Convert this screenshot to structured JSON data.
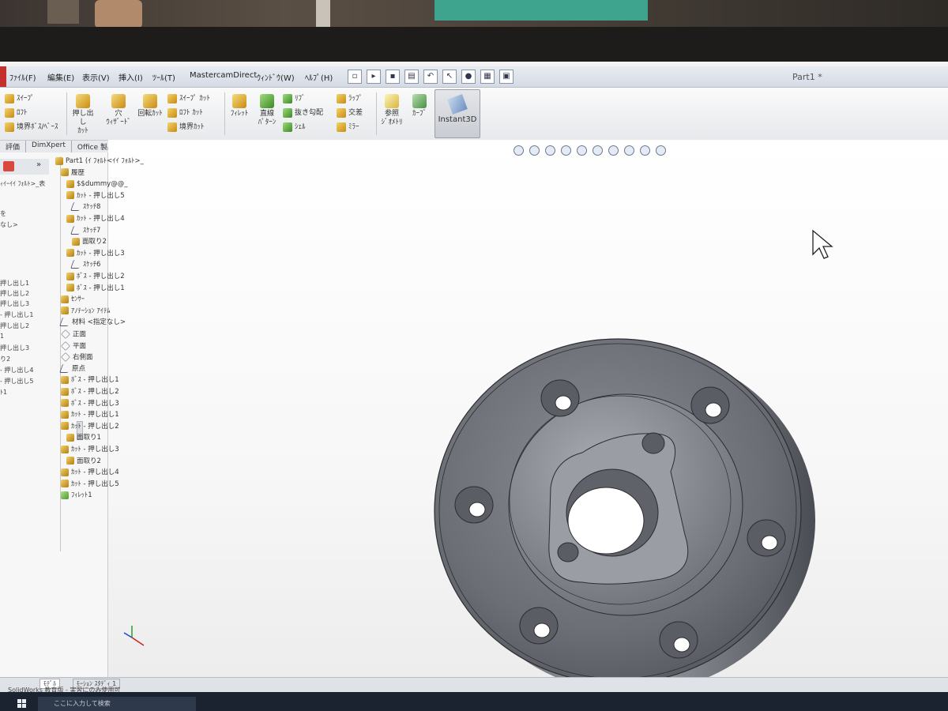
{
  "window": {
    "doc_title": "Part1 *"
  },
  "menu": [
    {
      "label": "ﾌｧｲﾙ(F)"
    },
    {
      "label": "編集(E)"
    },
    {
      "label": "表示(V)"
    },
    {
      "label": "挿入(I)"
    },
    {
      "label": "ﾂｰﾙ(T)"
    },
    {
      "label": "MastercamDirect"
    },
    {
      "label": "ｳｨﾝﾄﾞｳ(W)"
    },
    {
      "label": "ﾍﾙﾌﾟ(H)"
    }
  ],
  "ribbon": {
    "sweep": "ｽｲｰﾌﾟ",
    "loft": "ﾛﾌﾄ",
    "boundary_boss": "境界ﾎﾞｽ/ﾍﾞｰｽ",
    "extrude_cut": "押し出し\nｶｯﾄ",
    "hole_wizard": "穴\nｳｨｻﾞｰﾄﾞ",
    "revolve_cut": "回転ｶｯﾄ",
    "sweep_cut": "ｽｲｰﾌﾟ ｶｯﾄ",
    "loft_cut": "ﾛﾌﾄ ｶｯﾄ",
    "boundary_cut": "境界ｶｯﾄ",
    "fillet": "ﾌｨﾚｯﾄ",
    "linear_pattern": "直線\nﾊﾟﾀｰﾝ",
    "rib": "ﾘﾌﾞ",
    "draft": "抜き勾配",
    "shell": "ｼｪﾙ",
    "wrap": "ﾗｯﾌﾟ",
    "intersect": "交差",
    "mirror": "ﾐﾗｰ",
    "ref_geometry": "参照\nｼﾞｵﾒﾄﾘ",
    "curves": "ｶｰﾌﾞ",
    "instant3d": "Instant3D"
  },
  "tabs": [
    {
      "label": "評価"
    },
    {
      "label": "DimXpert"
    },
    {
      "label": "Office 製品"
    }
  ],
  "left_panel": {
    "lines": [
      "ｨｲｰｲｲ ﾌｫﾙﾄ>_表",
      "を",
      "なし>",
      "押し出し1",
      "押し出し2",
      "押し出し3",
      "- 押し出し1",
      "押し出し2",
      "1",
      "押し出し3",
      "り2",
      "- 押し出し4",
      "- 押し出し5",
      "ﾄ1"
    ]
  },
  "tree": [
    {
      "label": "Part1 (ｲ ﾌｫﾙﾄ<ｲｲ ﾌｫﾙﾄ>_",
      "icon": "part"
    },
    {
      "label": "履歴",
      "icon": "folder"
    },
    {
      "label": "$$dummy@@_",
      "icon": "feat"
    },
    {
      "label": "ｶｯﾄ - 押し出し5",
      "icon": "feat"
    },
    {
      "label": "ｽｹｯﾁ8",
      "icon": "sketch"
    },
    {
      "label": "ｶｯﾄ - 押し出し4",
      "icon": "feat"
    },
    {
      "label": "ｽｹｯﾁ7",
      "icon": "sketch"
    },
    {
      "label": "面取り2",
      "icon": "feat"
    },
    {
      "label": "ｶｯﾄ - 押し出し3",
      "icon": "feat"
    },
    {
      "label": "ｽｹｯﾁ6",
      "icon": "sketch"
    },
    {
      "label": "ﾎﾞｽ - 押し出し2",
      "icon": "feat"
    },
    {
      "label": "ﾎﾞｽ - 押し出し1",
      "icon": "feat"
    },
    {
      "label": "ｾﾝｻｰ",
      "icon": "feat"
    },
    {
      "label": "ｱﾉﾃｰｼｮﾝ ｱｲﾃﾑ",
      "icon": "feat"
    },
    {
      "label": "材料 <指定なし>",
      "icon": "sketch"
    },
    {
      "label": "正面",
      "icon": "plane"
    },
    {
      "label": "平面",
      "icon": "plane"
    },
    {
      "label": "右側面",
      "icon": "plane"
    },
    {
      "label": "原点",
      "icon": "sketch"
    },
    {
      "label": "ﾎﾞｽ - 押し出し1",
      "icon": "feat"
    },
    {
      "label": "ﾎﾞｽ - 押し出し2",
      "icon": "feat"
    },
    {
      "label": "ﾎﾞｽ - 押し出し3",
      "icon": "feat"
    },
    {
      "label": "ｶｯﾄ - 押し出し1",
      "icon": "feat"
    },
    {
      "label": "ｶｯﾄ - 押し出し2",
      "icon": "feat"
    },
    {
      "label": "面取り1",
      "icon": "feat"
    },
    {
      "label": "ｶｯﾄ - 押し出し3",
      "icon": "feat"
    },
    {
      "label": "面取り2",
      "icon": "feat"
    },
    {
      "label": "ｶｯﾄ - 押し出し4",
      "icon": "feat"
    },
    {
      "label": "ｶｯﾄ - 押し出し5",
      "icon": "feat"
    },
    {
      "label": "ﾌｨﾚｯﾄ1",
      "icon": "green"
    }
  ],
  "status": {
    "bottom_tabs": [
      "ﾓﾃﾞﾙ",
      "ﾓｰｼｮﾝ ｽﾀﾃﾞｨ 1"
    ],
    "product": "SolidWorks 教育版 - 実習にのみ使用可",
    "search_placeholder": "ここに入力して検索"
  }
}
